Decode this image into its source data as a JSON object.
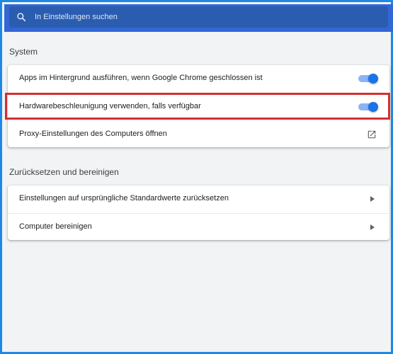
{
  "search": {
    "placeholder": "In Einstellungen suchen"
  },
  "system": {
    "title": "System",
    "items": [
      {
        "label": "Apps im Hintergrund ausführen, wenn Google Chrome geschlossen ist",
        "control": "toggle",
        "enabled": true
      },
      {
        "label": "Hardwarebeschleunigung verwenden, falls verfügbar",
        "control": "toggle",
        "enabled": true,
        "highlighted": true
      },
      {
        "label": "Proxy-Einstellungen des Computers öffnen",
        "control": "open-in-new-icon"
      }
    ]
  },
  "reset": {
    "title": "Zurücksetzen und bereinigen",
    "items": [
      {
        "label": "Einstellungen auf ursprüngliche Standardwerte zurücksetzen",
        "control": "arrow-right-icon"
      },
      {
        "label": "Computer bereinigen",
        "control": "arrow-right-icon"
      }
    ]
  },
  "colors": {
    "header": "#3367d6",
    "search_bg": "#2a5db0",
    "toggle_on": "#1a73e8",
    "highlight_border": "#d32f2f",
    "frame_border": "#1e88e5"
  }
}
